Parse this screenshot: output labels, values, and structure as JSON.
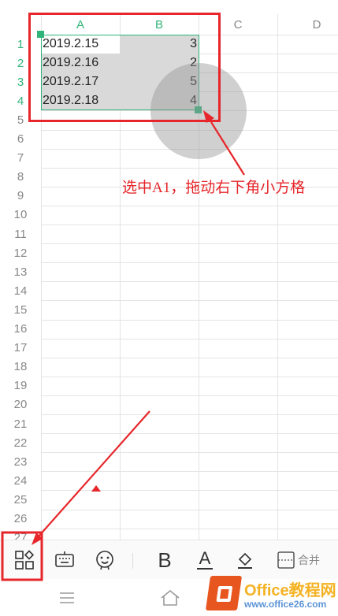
{
  "columns": [
    "A",
    "B",
    "C",
    "D"
  ],
  "rows": [
    "1",
    "2",
    "3",
    "4",
    "5",
    "6",
    "7",
    "8",
    "9",
    "10",
    "11",
    "12",
    "13",
    "14",
    "15",
    "16",
    "17",
    "18",
    "19",
    "20",
    "21",
    "22",
    "23",
    "24",
    "25",
    "26",
    "27"
  ],
  "cells": [
    {
      "a": "2019.2.15",
      "b": "3"
    },
    {
      "a": "2019.2.16",
      "b": "2"
    },
    {
      "a": "2019.2.17",
      "b": "5"
    },
    {
      "a": "2019.2.18",
      "b": "4"
    }
  ],
  "annotation": {
    "note": "选中A1，拖动右下角小方格",
    "color": "#e6262a"
  },
  "toolbar": {
    "icons": [
      "apps-icon",
      "keyboard-icon",
      "emoji-icon",
      "bold-icon",
      "font-color-icon",
      "fill-color-icon",
      "border-icon"
    ],
    "bold_label": "B",
    "font_color_label": "A",
    "merge_label": "合并"
  },
  "watermark": {
    "title": "Office教程网",
    "url": "www.office26.com"
  },
  "colors": {
    "accent": "#2fb47a",
    "selection_fill": "#d9d9d9",
    "annotation": "#e6262a",
    "watermark_orange": "#e8561f",
    "watermark_gold": "#f4b223",
    "watermark_blue": "#5b93d6"
  }
}
